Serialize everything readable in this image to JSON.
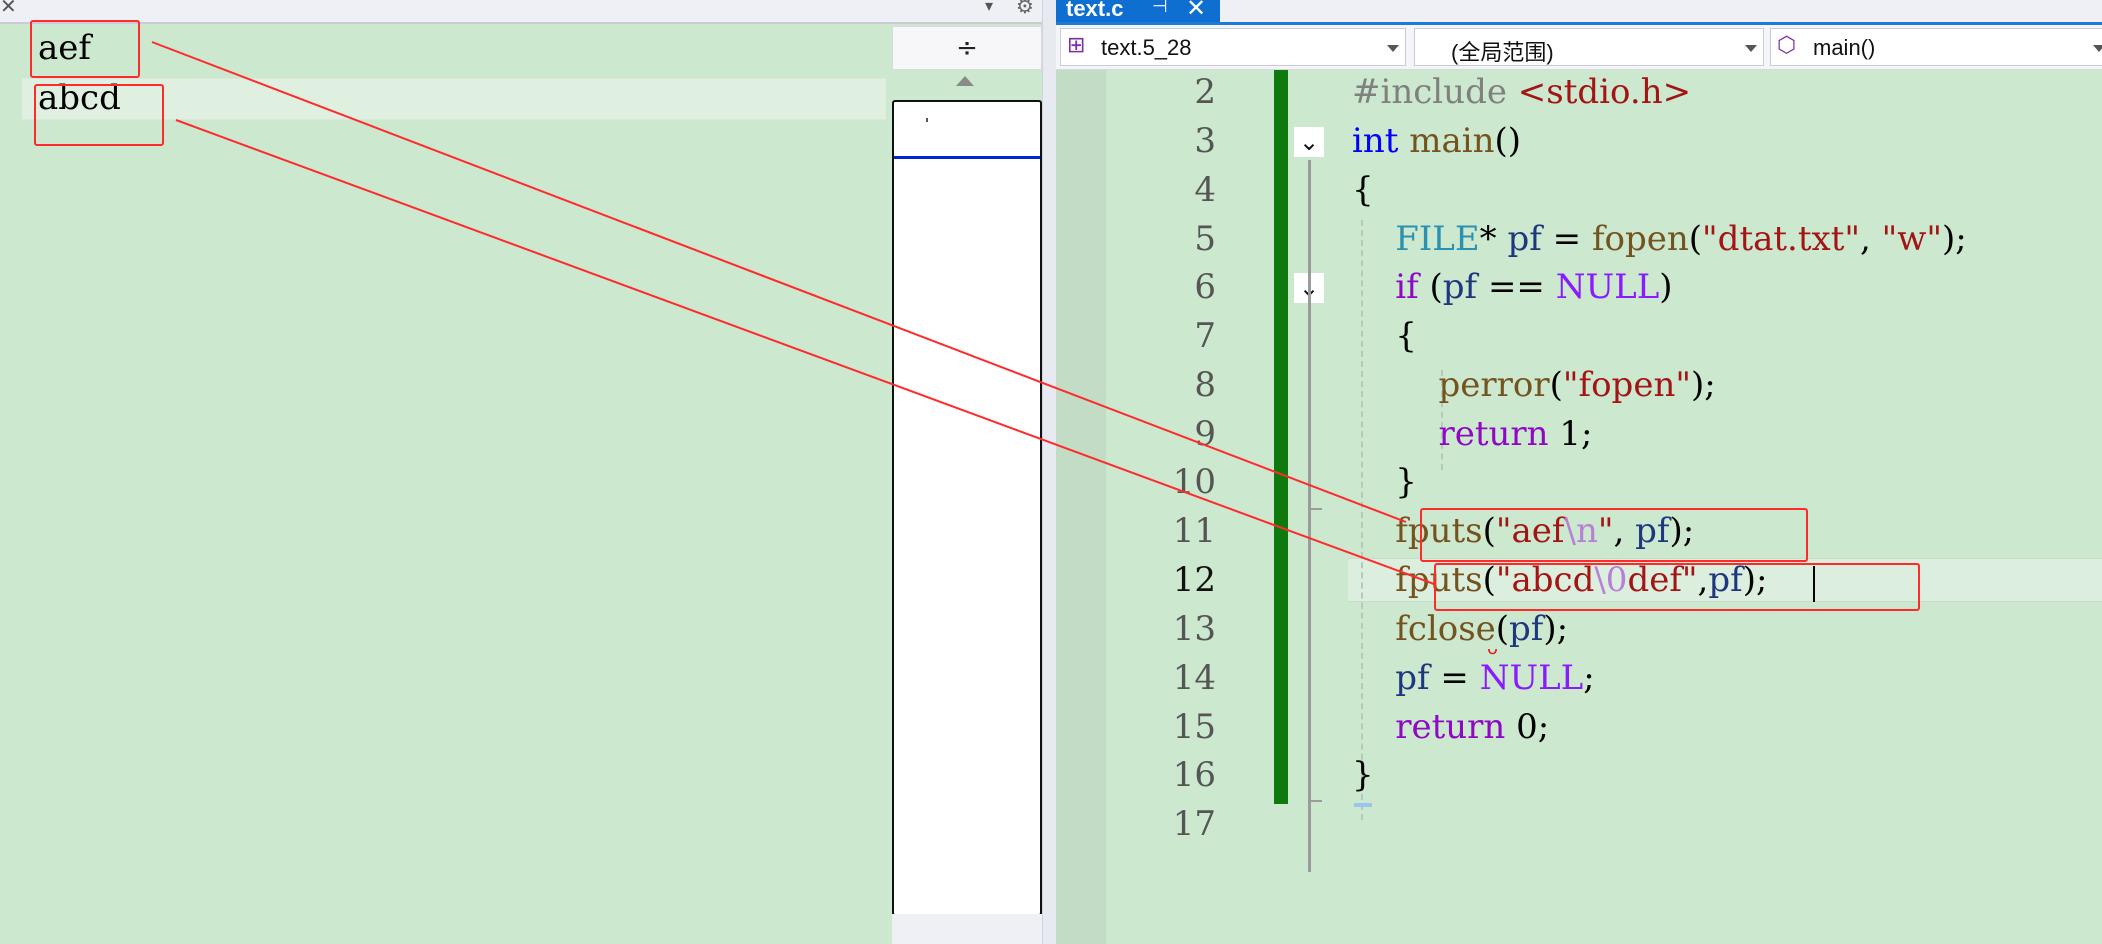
{
  "left_pane": {
    "close_glyph": "✕",
    "menu_glyph": "▾",
    "gear_glyph": "⚙",
    "file_lines": [
      "aef",
      "abcd"
    ],
    "split_glyph": "÷"
  },
  "tab": {
    "title": "text.c",
    "pin_glyph": "⊣",
    "close_glyph": "✕"
  },
  "navbar": {
    "project": "text.5_28",
    "scope": "(全局范围)",
    "function": "main()",
    "project_icon": "project-icon",
    "function_icon": "cube-icon"
  },
  "editor": {
    "line_numbers": [
      "2",
      "3",
      "4",
      "5",
      "6",
      "7",
      "8",
      "9",
      "10",
      "11",
      "12",
      "13",
      "14",
      "15",
      "16",
      "17"
    ],
    "current_line": "12",
    "fold_glyph": "⌄"
  },
  "colors": {
    "background": "#cce8cf",
    "tab_active": "#0e6fd0",
    "change_bar": "#0e7a0e",
    "annotation": "#ff2a2a"
  }
}
